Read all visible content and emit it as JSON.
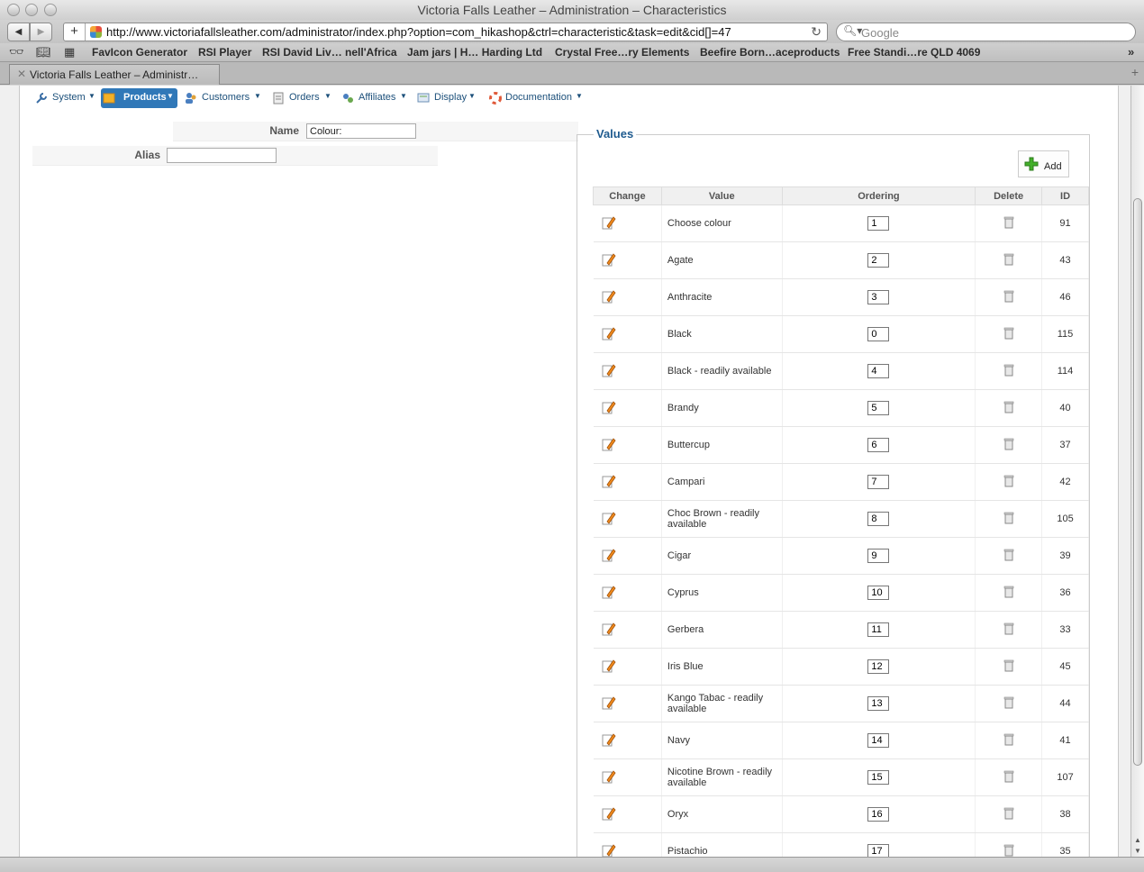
{
  "window": {
    "title": "Victoria Falls Leather – Administration – Characteristics"
  },
  "toolbar": {
    "url": "http://www.victoriafallsleather.com/administrator/index.php?option=com_hikashop&ctrl=characteristic&task=edit&cid[]=47",
    "search_placeholder": "Google"
  },
  "bookmarks": [
    "FavIcon Generator",
    "RSI Player",
    "RSI David Liv… nell'Africa",
    "Jam jars | H… Harding Ltd",
    "Crystal Free…ry Elements",
    "Beefire Born…aceproducts",
    "Free Standi…re QLD 4069"
  ],
  "tab": {
    "title": "Victoria Falls Leather – Administr…"
  },
  "menu": [
    "System",
    "Products",
    "Customers",
    "Orders",
    "Affiliates",
    "Display",
    "Documentation"
  ],
  "form": {
    "name_label": "Name",
    "name_value": "Colour:",
    "alias_label": "Alias",
    "alias_value": ""
  },
  "values_panel": {
    "legend": "Values",
    "add_label": "Add",
    "headers": [
      "Change",
      "Value",
      "Ordering",
      "Delete",
      "ID"
    ],
    "rows": [
      {
        "value": "Choose colour",
        "ordering": "1",
        "id": "91"
      },
      {
        "value": "Agate",
        "ordering": "2",
        "id": "43"
      },
      {
        "value": "Anthracite",
        "ordering": "3",
        "id": "46"
      },
      {
        "value": "Black",
        "ordering": "0",
        "id": "115"
      },
      {
        "value": "Black - readily available",
        "ordering": "4",
        "id": "114"
      },
      {
        "value": "Brandy",
        "ordering": "5",
        "id": "40"
      },
      {
        "value": "Buttercup",
        "ordering": "6",
        "id": "37"
      },
      {
        "value": "Campari",
        "ordering": "7",
        "id": "42"
      },
      {
        "value": "Choc Brown - readily available",
        "ordering": "8",
        "id": "105"
      },
      {
        "value": "Cigar",
        "ordering": "9",
        "id": "39"
      },
      {
        "value": "Cyprus",
        "ordering": "10",
        "id": "36"
      },
      {
        "value": "Gerbera",
        "ordering": "11",
        "id": "33"
      },
      {
        "value": "Iris Blue",
        "ordering": "12",
        "id": "45"
      },
      {
        "value": "Kango Tabac - readily available",
        "ordering": "13",
        "id": "44"
      },
      {
        "value": "Navy",
        "ordering": "14",
        "id": "41"
      },
      {
        "value": "Nicotine Brown - readily available",
        "ordering": "15",
        "id": "107"
      },
      {
        "value": "Oryx",
        "ordering": "16",
        "id": "38"
      },
      {
        "value": "Pistachio",
        "ordering": "17",
        "id": "35"
      }
    ]
  },
  "colors": {
    "accent": "#3078b8",
    "legend": "#1f5b8f",
    "menu_text": "#1b4f7a"
  }
}
